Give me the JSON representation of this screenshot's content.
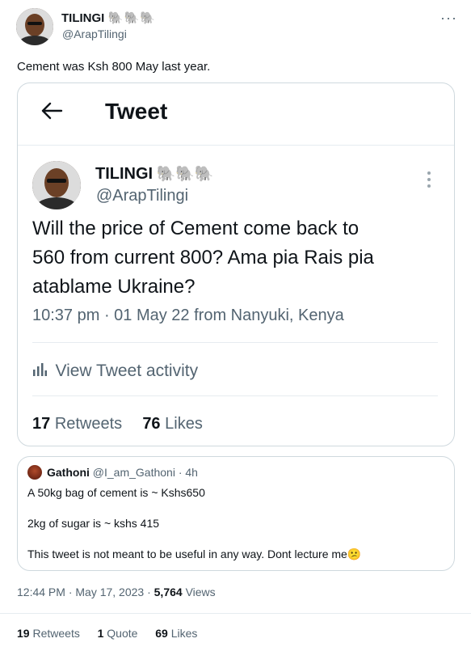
{
  "tweet": {
    "author_name": "TILINGI",
    "author_emoji": "🐘🐘🐘",
    "author_handle": "@ArapTilingi",
    "more_icon": "more-dots-icon",
    "text": "Cement was Ksh 800 May last year."
  },
  "embedded": {
    "back_icon": "back-arrow-icon",
    "header_title": "Tweet",
    "author_name": "TILINGI",
    "author_emoji": "🐘🐘🐘",
    "author_handle": "@ArapTilingi",
    "more_icon": "more-vertical-icon",
    "text_line1": "Will the price of Cement come back to",
    "text_line2": "560 from current 800? Ama pia Rais pia",
    "text_line3": "atablame Ukraine?",
    "meta": "10:37 pm · 01 May 22 from Nanyuki, Kenya",
    "activity_icon": "analytics-icon",
    "activity_label": "View Tweet activity",
    "retweets_count": "17",
    "retweets_label": "Retweets",
    "likes_count": "76",
    "likes_label": "Likes"
  },
  "quote": {
    "author_name": "Gathoni",
    "author_handle": "@I_am_Gathoni",
    "time": "· 4h",
    "line1": "A 50kg bag of cement is ~ Kshs650",
    "line2": "2kg of sugar is ~ kshs 415",
    "line3": "This tweet is not meant to be useful in any way. Dont lecture me",
    "emoji": "😕"
  },
  "footer": {
    "timestamp": "12:44 PM · May 17, 2023 · ",
    "views_count": "5,764",
    "views_label": " Views",
    "retweets_count": "19",
    "retweets_label": "Retweets",
    "quotes_count": "1",
    "quotes_label": "Quote",
    "likes_count": "69",
    "likes_label": "Likes"
  }
}
